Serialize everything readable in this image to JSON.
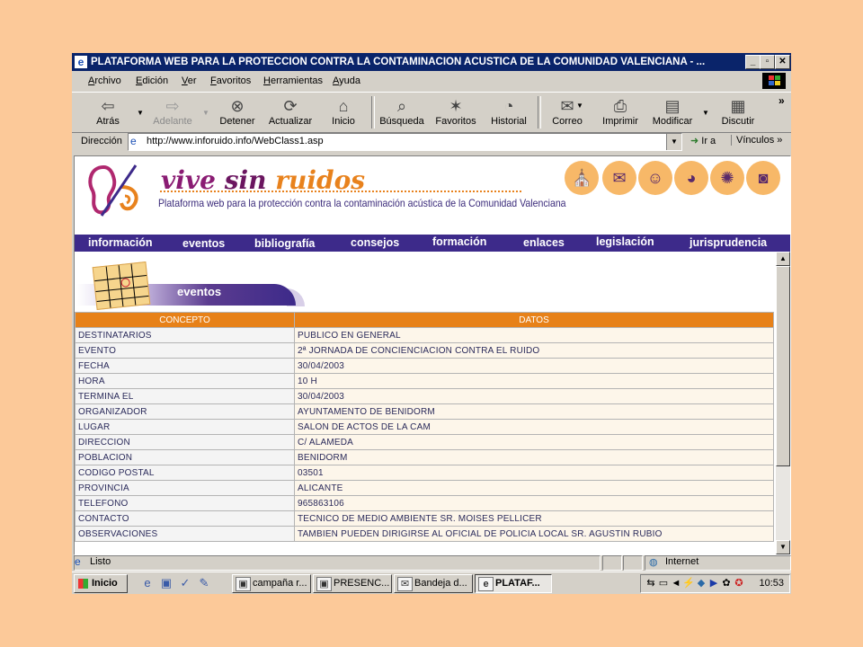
{
  "window": {
    "title": "PLATAFORMA WEB PARA LA PROTECCION CONTRA LA CONTAMINACION ACUSTICA DE LA COMUNIDAD VALENCIANA - ...",
    "ie_glyph": "e"
  },
  "menu": [
    "Archivo",
    "Edición",
    "Ver",
    "Favoritos",
    "Herramientas",
    "Ayuda"
  ],
  "toolbar": {
    "back": "Atrás",
    "forward": "Adelante",
    "stop": "Detener",
    "refresh": "Actualizar",
    "home": "Inicio",
    "search": "Búsqueda",
    "favorites": "Favoritos",
    "history": "Historial",
    "mail": "Correo",
    "print": "Imprimir",
    "edit": "Modificar",
    "discuss": "Discutir",
    "more": "»"
  },
  "address": {
    "label": "Dirección",
    "url": "http://www.inforuido.info/WebClass1.asp",
    "go": "Ir a",
    "links": "Vínculos »"
  },
  "site": {
    "brand_1": "vive",
    "brand_2": "sin",
    "brand_3": "ruidos",
    "subtitle": "Plataforma web para la protección contra la contaminación acústica de la Comunidad Valenciana",
    "nav": [
      "información",
      "eventos",
      "bibliografía",
      "consejos",
      "formación",
      "enlaces",
      "legislación",
      "jurisprudencia"
    ],
    "section_title": "eventos"
  },
  "table": {
    "headers": [
      "CONCEPTO",
      "DATOS"
    ],
    "rows": [
      [
        "DESTINATARIOS",
        "PUBLICO EN GENERAL"
      ],
      [
        "EVENTO",
        "2ª JORNADA DE CONCIENCIACION CONTRA EL RUIDO"
      ],
      [
        "FECHA",
        "30/04/2003"
      ],
      [
        "HORA",
        "10 H"
      ],
      [
        "TERMINA EL",
        "30/04/2003"
      ],
      [
        "ORGANIZADOR",
        "AYUNTAMENTO DE BENIDORM"
      ],
      [
        "LUGAR",
        "SALON DE ACTOS DE LA CAM"
      ],
      [
        "DIRECCION",
        "C/ ALAMEDA"
      ],
      [
        "POBLACION",
        "BENIDORM"
      ],
      [
        "CODIGO POSTAL",
        "03501"
      ],
      [
        "PROVINCIA",
        "ALICANTE"
      ],
      [
        "TELEFONO",
        "965863106"
      ],
      [
        "CONTACTO",
        "TECNICO DE MEDIO AMBIENTE SR. MOISES PELLICER"
      ],
      [
        "OBSERVACIONES",
        "TAMBIEN PUEDEN DIRIGIRSE AL OFICIAL DE POLICIA LOCAL SR. AGUSTIN RUBIO"
      ]
    ]
  },
  "statusbar": {
    "text": "Listo",
    "zone": "Internet"
  },
  "taskbar": {
    "start": "Inicio",
    "tasks": [
      "campaña r...",
      "PRESENC...",
      "Bandeja d...",
      "PLATAF..."
    ],
    "clock": "10:53"
  },
  "colors": {
    "desktop": "#fcc999",
    "titlebar": "#0a246a",
    "nav": "#3d2a8a",
    "table_header": "#e78118",
    "brand_purple": "#8a1c73",
    "brand_orange": "#e8821d"
  }
}
